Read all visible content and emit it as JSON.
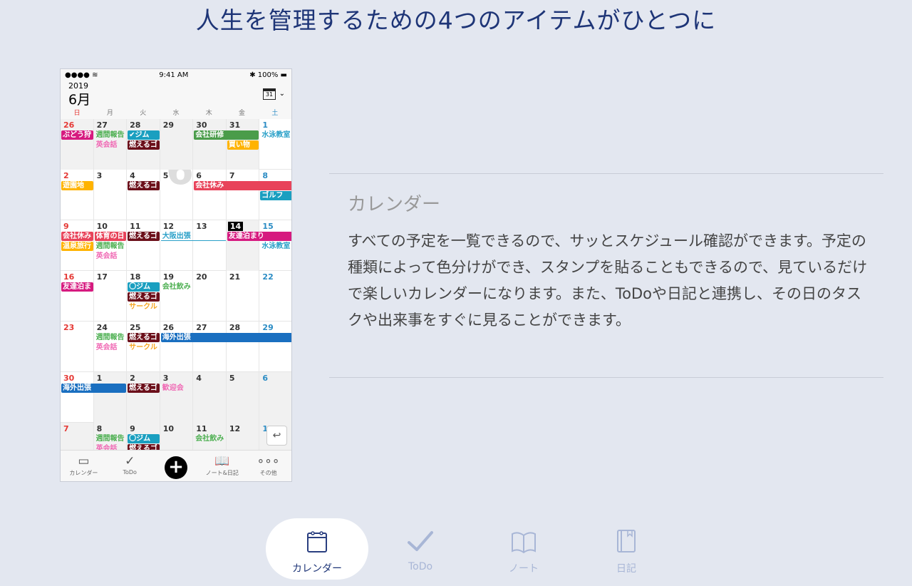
{
  "title": "人生を管理するための4つのアイテムがひとつに",
  "phone": {
    "status": {
      "time": "9:41 AM",
      "battery": "100%",
      "signal": "●●●● ≋"
    },
    "year": "2019",
    "month": "6月",
    "calendar_icon_day": "31",
    "weekdays": [
      "日",
      "月",
      "火",
      "水",
      "木",
      "金",
      "土"
    ],
    "watermark": "6",
    "weeks": [
      {
        "days": [
          "26",
          "27",
          "28",
          "29",
          "30",
          "31",
          "1"
        ],
        "gray": [
          0,
          1,
          2,
          3,
          4,
          5
        ],
        "events": [
          {
            "col": 0,
            "span": 1,
            "lane": 0,
            "label": "ぶどう狩",
            "color": "#d61a7f",
            "kind": "bar"
          },
          {
            "col": 1,
            "span": 1,
            "lane": 0,
            "label": "週間報告",
            "color": "#4caf50",
            "kind": "text"
          },
          {
            "col": 1,
            "span": 1,
            "lane": 1,
            "label": "英会話",
            "color": "#f06bb5",
            "kind": "text"
          },
          {
            "col": 2,
            "span": 1,
            "lane": 0,
            "label": "✔ジム",
            "color": "#1a9fc0",
            "kind": "bar"
          },
          {
            "col": 2,
            "span": 1,
            "lane": 1,
            "label": "燃えるゴ",
            "color": "#6b0f1a",
            "kind": "bar"
          },
          {
            "col": 4,
            "span": 2,
            "lane": 0,
            "label": "会社研修",
            "color": "#4a9c4a",
            "kind": "bar"
          },
          {
            "col": 5,
            "span": 1,
            "lane": 1,
            "label": "買い物",
            "color": "#ffb300",
            "kind": "bar"
          },
          {
            "col": 6,
            "span": 1,
            "lane": 0,
            "label": "水泳教室",
            "color": "#2aa0c8",
            "kind": "text"
          }
        ]
      },
      {
        "days": [
          "2",
          "3",
          "4",
          "5",
          "6",
          "7",
          "8"
        ],
        "gray": [],
        "events": [
          {
            "col": 0,
            "span": 1,
            "lane": 0,
            "label": "遊園地",
            "color": "#ffb300",
            "kind": "bar"
          },
          {
            "col": 2,
            "span": 1,
            "lane": 0,
            "label": "燃えるゴ",
            "color": "#6b0f1a",
            "kind": "bar"
          },
          {
            "col": 4,
            "span": 3,
            "lane": 0,
            "label": "会社休み",
            "color": "#e8435a",
            "kind": "bar"
          },
          {
            "col": 6,
            "span": 1,
            "lane": 1,
            "label": "ゴルフ",
            "color": "#1a9fc0",
            "kind": "bar"
          }
        ]
      },
      {
        "days": [
          "9",
          "10",
          "11",
          "12",
          "13",
          "14",
          "15"
        ],
        "gray": [
          5
        ],
        "today": 5,
        "events": [
          {
            "col": 0,
            "span": 1,
            "lane": 0,
            "label": "会社休み",
            "color": "#e8435a",
            "kind": "bar"
          },
          {
            "col": 0,
            "span": 1,
            "lane": 1,
            "label": "温泉旅行",
            "color": "#ffb300",
            "kind": "bar"
          },
          {
            "col": 1,
            "span": 1,
            "lane": 0,
            "label": "体育の日",
            "color": "#e8435a",
            "kind": "bar"
          },
          {
            "col": 1,
            "span": 1,
            "lane": 1,
            "label": "週間報告",
            "color": "#4caf50",
            "kind": "text"
          },
          {
            "col": 1,
            "span": 1,
            "lane": 2,
            "label": "英会話",
            "color": "#f06bb5",
            "kind": "text"
          },
          {
            "col": 2,
            "span": 1,
            "lane": 0,
            "label": "燃えるゴ",
            "color": "#6b0f1a",
            "kind": "bar"
          },
          {
            "col": 3,
            "span": 2,
            "lane": 0,
            "label": "大阪出張",
            "color": "#2aa0c8",
            "kind": "line"
          },
          {
            "col": 5,
            "span": 2,
            "lane": 0,
            "label": "友達泊まり",
            "color": "#d61a7f",
            "kind": "bar"
          },
          {
            "col": 6,
            "span": 1,
            "lane": 1,
            "label": "水泳教室",
            "color": "#2aa0c8",
            "kind": "text"
          }
        ]
      },
      {
        "days": [
          "16",
          "17",
          "18",
          "19",
          "20",
          "21",
          "22"
        ],
        "gray": [],
        "events": [
          {
            "col": 0,
            "span": 1,
            "lane": 0,
            "label": "友達泊ま",
            "color": "#d61a7f",
            "kind": "bar"
          },
          {
            "col": 2,
            "span": 1,
            "lane": 0,
            "label": "〇ジム",
            "color": "#1a9fc0",
            "kind": "bar"
          },
          {
            "col": 2,
            "span": 1,
            "lane": 1,
            "label": "燃えるゴ",
            "color": "#6b0f1a",
            "kind": "bar"
          },
          {
            "col": 2,
            "span": 1,
            "lane": 2,
            "label": "サークル",
            "color": "#f5a623",
            "kind": "text"
          },
          {
            "col": 3,
            "span": 1,
            "lane": 0,
            "label": "会社飲み",
            "color": "#4caf50",
            "kind": "text"
          }
        ]
      },
      {
        "days": [
          "23",
          "24",
          "25",
          "26",
          "27",
          "28",
          "29"
        ],
        "gray": [],
        "events": [
          {
            "col": 1,
            "span": 1,
            "lane": 0,
            "label": "週間報告",
            "color": "#4caf50",
            "kind": "text"
          },
          {
            "col": 1,
            "span": 1,
            "lane": 1,
            "label": "英会話",
            "color": "#f06bb5",
            "kind": "text"
          },
          {
            "col": 2,
            "span": 1,
            "lane": 0,
            "label": "燃えるゴ",
            "color": "#6b0f1a",
            "kind": "bar"
          },
          {
            "col": 2,
            "span": 1,
            "lane": 1,
            "label": "サークル",
            "color": "#f5a623",
            "kind": "text"
          },
          {
            "col": 3,
            "span": 4,
            "lane": 0,
            "label": "海外出張",
            "color": "#1a6fc0",
            "kind": "bar"
          }
        ]
      },
      {
        "days": [
          "30",
          "1",
          "2",
          "3",
          "4",
          "5",
          "6"
        ],
        "gray": [
          1,
          2,
          3,
          4,
          5,
          6
        ],
        "events": [
          {
            "col": 0,
            "span": 2,
            "lane": 0,
            "label": "海外出張",
            "color": "#1a6fc0",
            "kind": "bar"
          },
          {
            "col": 2,
            "span": 1,
            "lane": 0,
            "label": "燃えるゴ",
            "color": "#6b0f1a",
            "kind": "bar"
          },
          {
            "col": 3,
            "span": 1,
            "lane": 0,
            "label": "歓迎会",
            "color": "#f06bb5",
            "kind": "text"
          }
        ]
      },
      {
        "days": [
          "7",
          "8",
          "9",
          "10",
          "11",
          "12",
          "13"
        ],
        "gray": [
          0,
          1,
          2,
          3,
          4,
          5,
          6
        ],
        "events": [
          {
            "col": 1,
            "span": 1,
            "lane": 0,
            "label": "週間報告",
            "color": "#4caf50",
            "kind": "text"
          },
          {
            "col": 1,
            "span": 1,
            "lane": 1,
            "label": "英会話",
            "color": "#f06bb5",
            "kind": "text"
          },
          {
            "col": 2,
            "span": 1,
            "lane": 0,
            "label": "〇ジム",
            "color": "#1a9fc0",
            "kind": "bar"
          },
          {
            "col": 2,
            "span": 1,
            "lane": 1,
            "label": "燃えるゴ",
            "color": "#6b0f1a",
            "kind": "bar"
          },
          {
            "col": 4,
            "span": 1,
            "lane": 0,
            "label": "会社飲み",
            "color": "#4caf50",
            "kind": "text"
          }
        ]
      }
    ],
    "tabbar": [
      {
        "label": "カレンダー",
        "icon": "calendar-icon",
        "glyph": "▭"
      },
      {
        "label": "ToDo",
        "icon": "check-icon",
        "glyph": "✓"
      },
      {
        "label": "",
        "icon": "plus-icon",
        "glyph": "+"
      },
      {
        "label": "ノート&日記",
        "icon": "book-icon",
        "glyph": "📖"
      },
      {
        "label": "その他",
        "icon": "more-icon",
        "glyph": "∘∘∘"
      }
    ],
    "undo_glyph": "↩"
  },
  "section": {
    "heading": "カレンダー",
    "body": "すべての予定を一覧できるので、サッとスケジュール確認ができます。予定の種類によって色分けができ、スタンプを貼ることもできるので、見ているだけで楽しいカレンダーになります。また、ToDoや日記と連携し、その日のタスクや出来事をすぐに見ることができます。"
  },
  "nav": [
    {
      "label": "カレンダー",
      "icon": "calendar-icon",
      "active": true
    },
    {
      "label": "ToDo",
      "icon": "check-icon",
      "active": false
    },
    {
      "label": "ノート",
      "icon": "book-icon",
      "active": false
    },
    {
      "label": "日記",
      "icon": "diary-icon",
      "active": false
    }
  ],
  "colors": {
    "accent": "#1e3577",
    "inactive": "#a8b6d6",
    "background": "#e3e7f0"
  }
}
